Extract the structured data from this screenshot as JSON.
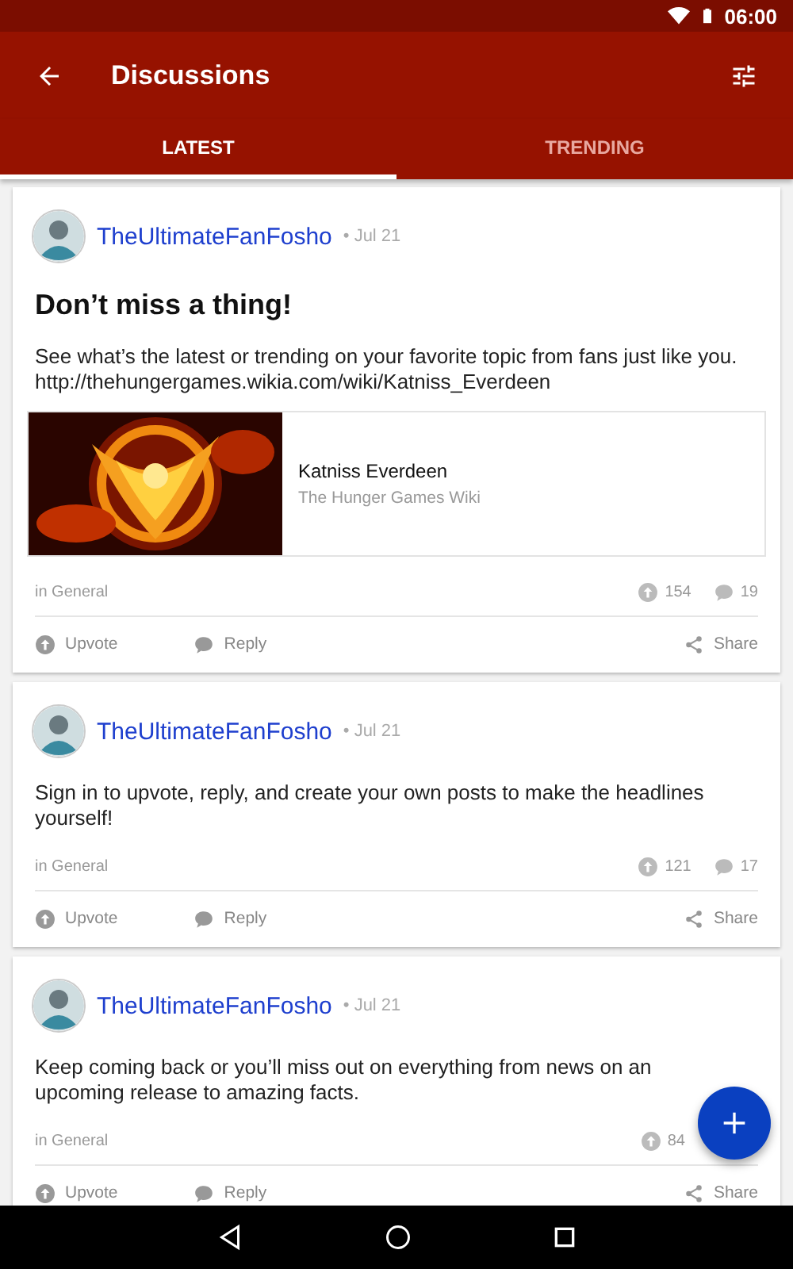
{
  "status_bar": {
    "time": "06:00"
  },
  "toolbar": {
    "title": "Discussions"
  },
  "tabs": [
    {
      "label": "LATEST",
      "selected": true
    },
    {
      "label": "TRENDING",
      "selected": false
    }
  ],
  "posts": [
    {
      "author": "TheUltimateFanFosho",
      "date": "• Jul 21",
      "title": "Don’t miss a thing!",
      "body": "See what’s the latest or trending on your favorite topic from fans just like you.",
      "link": "http://thehungergames.wikia.com/wiki/Katniss_Everdeen",
      "preview": {
        "kind": "picture",
        "title": "Katniss Everdeen",
        "source": "The Hunger Games Wiki"
      },
      "category": "in General",
      "upvotes": "154",
      "replies": "19",
      "actions": [
        "Upvote",
        "Reply",
        "Share"
      ]
    },
    {
      "author": "TheUltimateFanFosho",
      "date": "• Jul 21",
      "body": "Sign in to upvote, reply, and create your own posts to make the headlines yourself!",
      "category": "in General",
      "upvotes": "121",
      "replies": "17",
      "actions": [
        "Upvote",
        "Reply",
        "Share"
      ]
    },
    {
      "author": "TheUltimateFanFosho",
      "date": "• Jul 21",
      "body": "Keep coming back or you’ll miss out on everything from news on an upcoming release to amazing facts.",
      "category": "in General",
      "upvotes": "84",
      "actions": [
        "Upvote",
        "Reply",
        "Share"
      ]
    }
  ]
}
